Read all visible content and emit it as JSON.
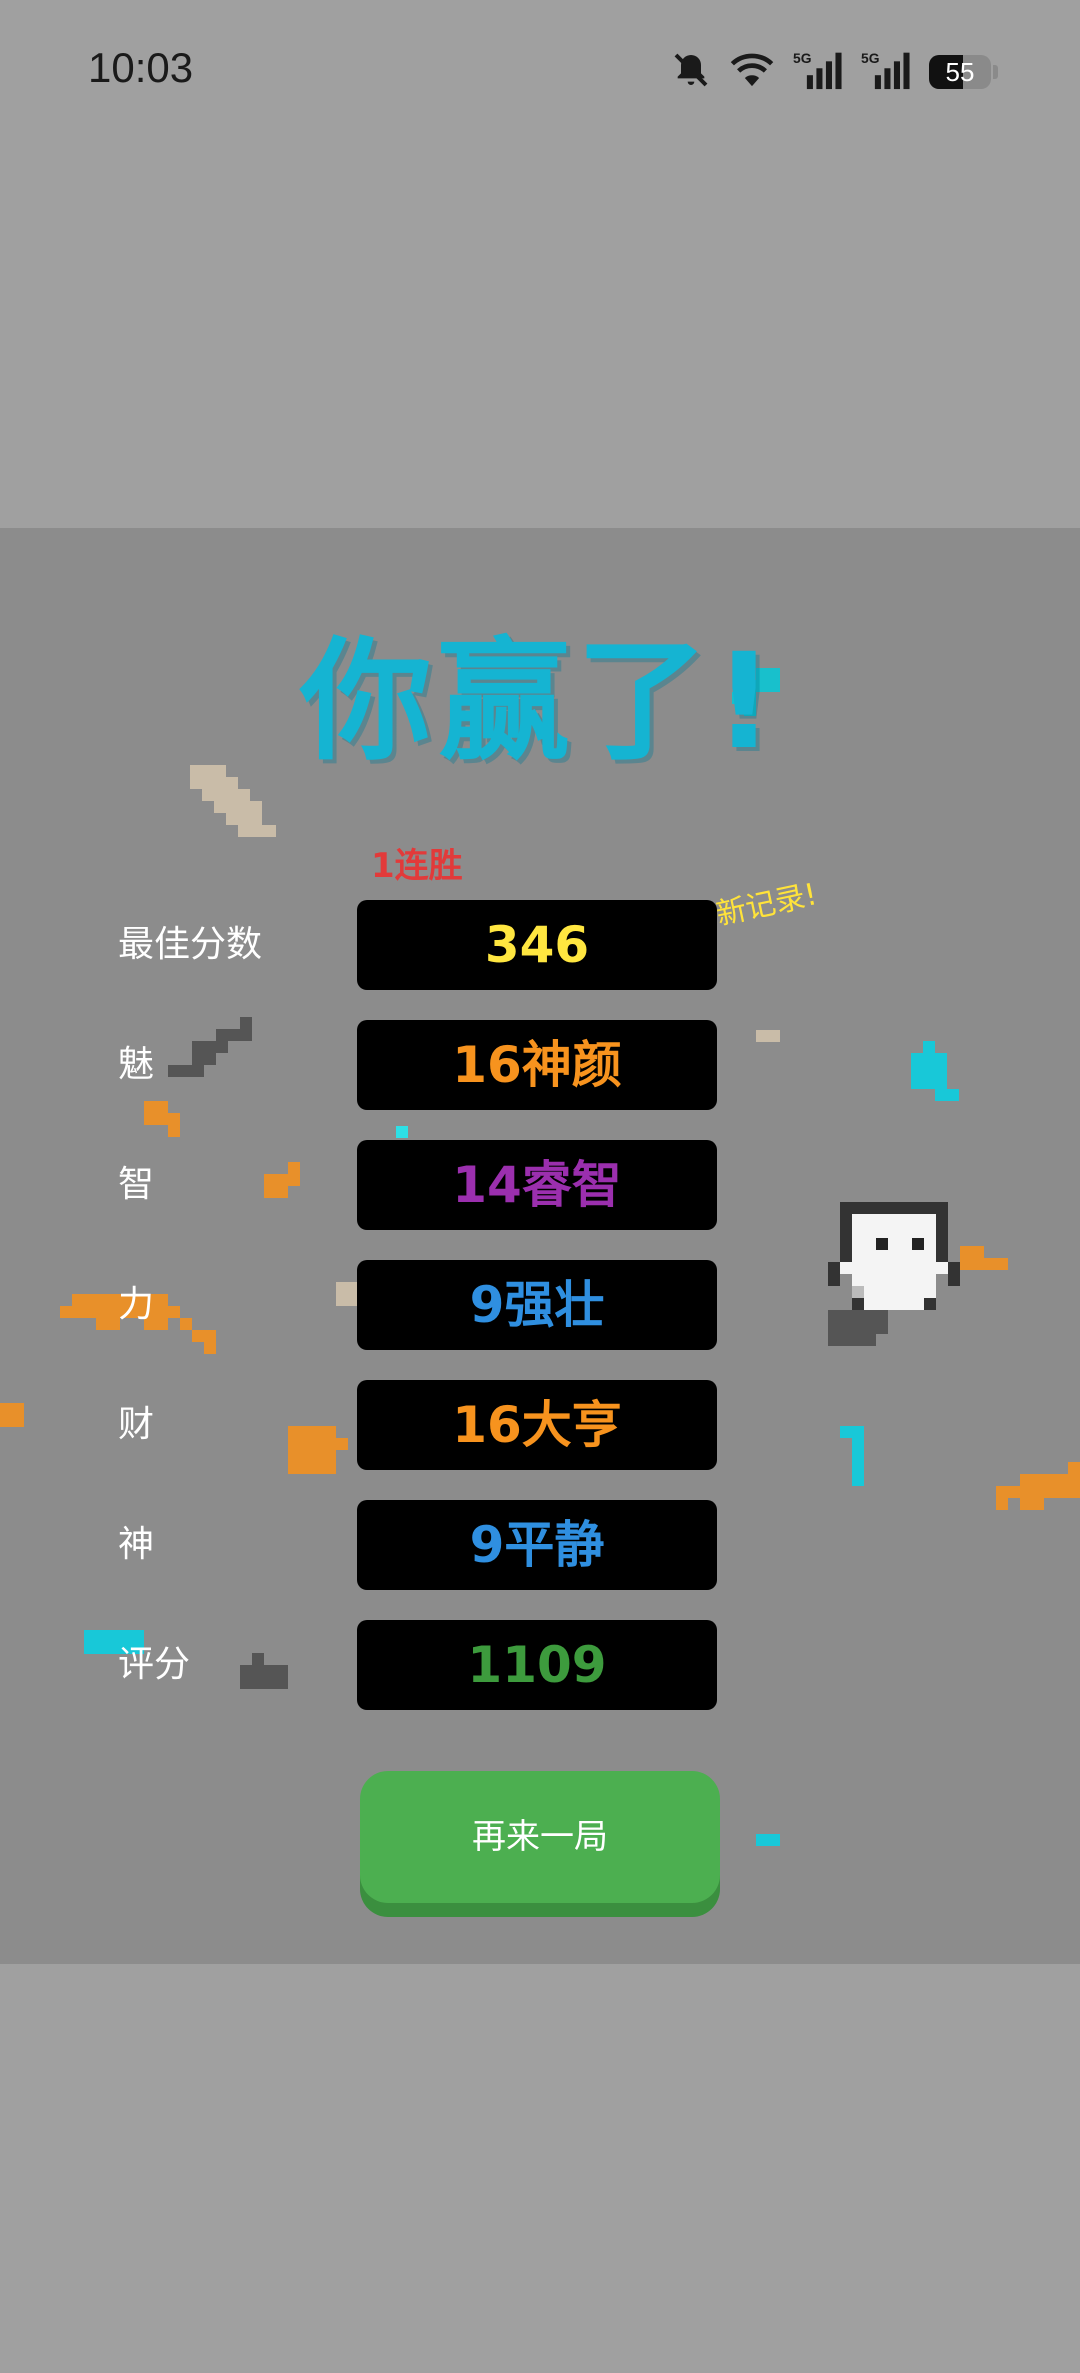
{
  "status_bar": {
    "time": "10:03",
    "battery_level": "55",
    "battery_fraction": 0.55,
    "icons": [
      "bell-muted-icon",
      "wifi-icon",
      "signal-5g-icon",
      "signal-5g-icon",
      "battery-icon"
    ],
    "signal_tag": "5G"
  },
  "result": {
    "title": "你赢了!",
    "streak": "1连胜",
    "new_record": "新记录!",
    "rows": [
      {
        "label": "最佳分数",
        "value": "346",
        "color": "#ffe640"
      },
      {
        "label": "魅",
        "value": "16神颜",
        "color": "#f7931e"
      },
      {
        "label": "智",
        "value": "14睿智",
        "color": "#9b2fae"
      },
      {
        "label": "力",
        "value": "9强壮",
        "color": "#2f8fe0"
      },
      {
        "label": "财",
        "value": "16大亨",
        "color": "#f7931e"
      },
      {
        "label": "神",
        "value": "9平静",
        "color": "#2f8fe0"
      },
      {
        "label": "评分",
        "value": "1109",
        "color": "#3d9b3d"
      }
    ]
  },
  "actions": {
    "play_again": "再来一局"
  },
  "colors": {
    "title": "#15b4d2",
    "streak": "#e23a3a",
    "new_record": "#ffe33a",
    "button": "#4caf50",
    "panel": "#8c8c8c",
    "background": "#a0a0a0"
  }
}
